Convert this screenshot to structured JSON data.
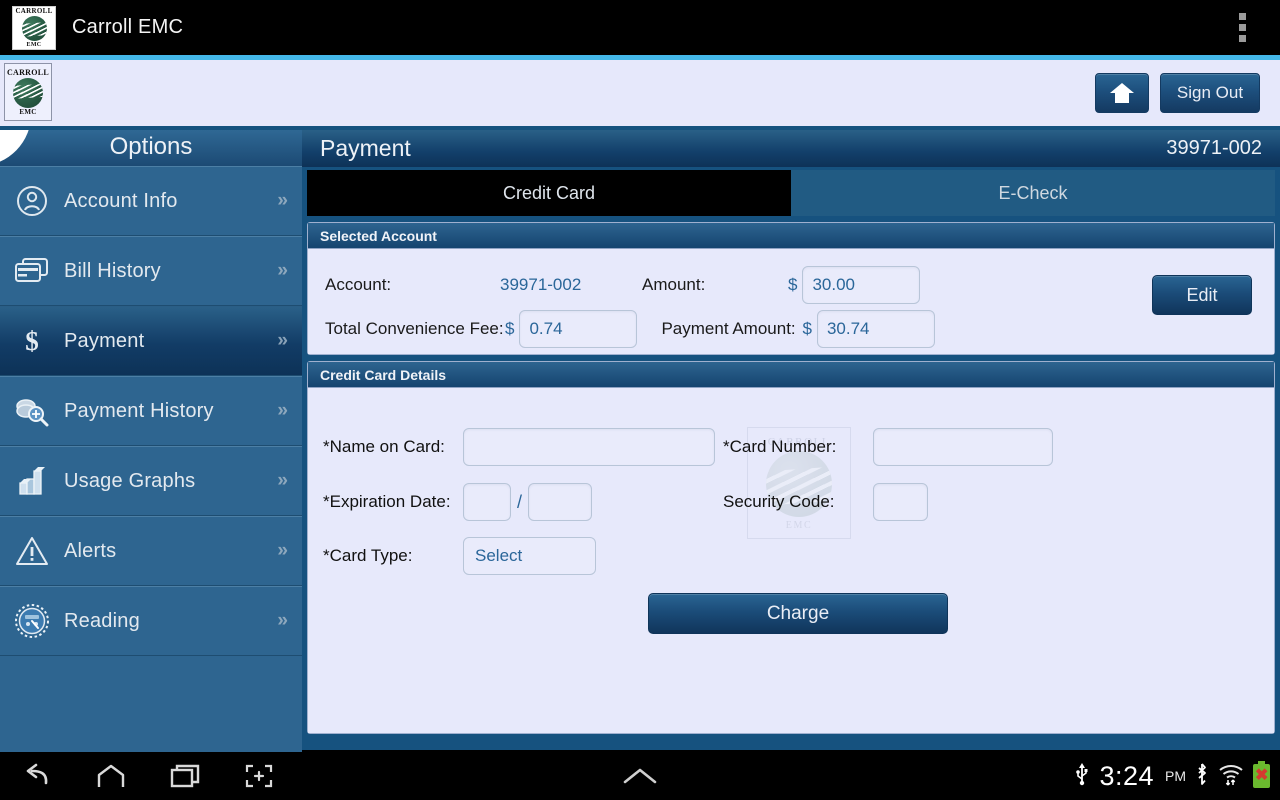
{
  "android": {
    "app_title": "Carroll EMC",
    "overflow_icon": "overflow-menu-icon",
    "logo_top_text": "CARROLL",
    "logo_bottom_text": "EMC"
  },
  "header": {
    "logo_top_text": "CARROLL",
    "logo_bottom_text": "EMC",
    "home_icon": "home-icon",
    "sign_out_label": "Sign Out"
  },
  "sidebar": {
    "title": "Options",
    "items": [
      {
        "label": "Account Info",
        "icon": "user-circle-icon",
        "active": false,
        "chevron": "»"
      },
      {
        "label": "Bill History",
        "icon": "credit-cards-icon",
        "active": false,
        "chevron": "»"
      },
      {
        "label": "Payment",
        "icon": "dollar-sign-icon",
        "active": true,
        "chevron": "»"
      },
      {
        "label": "Payment History",
        "icon": "money-search-icon",
        "active": false,
        "chevron": "»"
      },
      {
        "label": "Usage Graphs",
        "icon": "bar-chart-icon",
        "active": false,
        "chevron": "»"
      },
      {
        "label": "Alerts",
        "icon": "warning-triangle-icon",
        "active": false,
        "chevron": "»"
      },
      {
        "label": "Reading",
        "icon": "meter-gauge-icon",
        "active": false,
        "chevron": "»"
      }
    ]
  },
  "page": {
    "title": "Payment",
    "account_number": "39971-002"
  },
  "tabs": [
    {
      "label": "Credit Card",
      "active": true
    },
    {
      "label": "E-Check",
      "active": false
    }
  ],
  "selected_account": {
    "panel_title": "Selected Account",
    "account_label": "Account:",
    "account_value": "39971-002",
    "amount_label": "Amount:",
    "amount_currency": "$",
    "amount_value": "30.00",
    "fee_label": "Total Convenience Fee:",
    "fee_currency": "$",
    "fee_value": "0.74",
    "payment_label": "Payment Amount:",
    "payment_currency": "$",
    "payment_value": "30.74",
    "edit_label": "Edit"
  },
  "credit_card": {
    "panel_title": "Credit Card Details",
    "name_label": "*Name on Card:",
    "name_value": "",
    "card_number_label": "*Card Number:",
    "card_number_value": "",
    "expiration_label": "*Expiration Date:",
    "expiration_month": "",
    "expiration_year": "",
    "expiration_separator": "/",
    "security_label": "Security Code:",
    "security_value": "",
    "card_type_label": "*Card Type:",
    "card_type_value": "Select",
    "watermark_top": "CARROLL",
    "watermark_bottom": "EMC",
    "charge_label": "Charge"
  },
  "system_bar": {
    "back_icon": "back-arrow-icon",
    "home_icon": "home-outline-icon",
    "recents_icon": "recent-apps-icon",
    "screenshot_icon": "screenshot-icon",
    "handle_icon": "chevron-up-icon",
    "usb_icon": "usb-icon",
    "time": "3:24",
    "meridiem": "PM",
    "bluetooth_icon": "bluetooth-icon",
    "wifi_icon": "wifi-icon",
    "battery_icon": "battery-error-icon"
  },
  "colors": {
    "accent_cyan": "#44b7e8",
    "panel_bg": "#e7e9fb",
    "brand_blue": "#15527f",
    "sidebar_blue": "#2e6590",
    "value_blue": "#2a6699"
  }
}
